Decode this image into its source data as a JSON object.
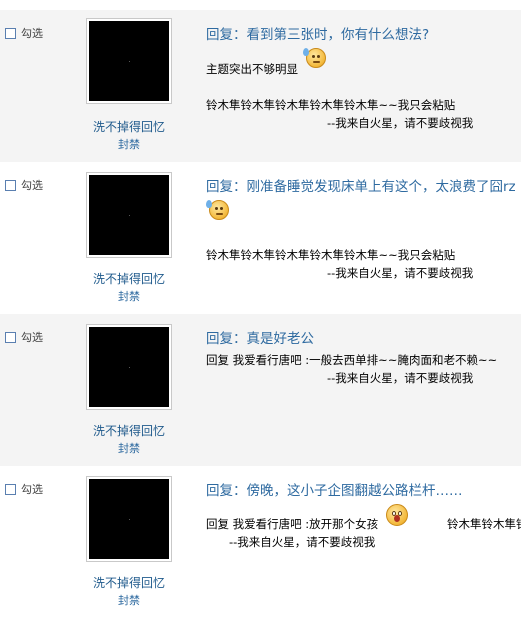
{
  "posts": [
    {
      "checkbox_label": "勾选",
      "username": "洗不掉得回忆",
      "ban_label": "封禁",
      "title": "回复：看到第三张时，你有什么想法?",
      "line1": "主题突出不够明显",
      "emoticon": "sweat-face-icon",
      "line2": "铃木隼铃木隼铃木隼铃木隼铃木隼~~我只会粘贴",
      "line3": "--我来自火星，请不要歧视我"
    },
    {
      "checkbox_label": "勾选",
      "username": "洗不掉得回忆",
      "ban_label": "封禁",
      "title": "回复：刚准备睡觉发现床单上有这个，太浪费了囧rz",
      "emoticon": "sweat-face-icon",
      "line2": "铃木隼铃木隼铃木隼铃木隼铃木隼~~我只会粘贴",
      "line3": "--我来自火星，请不要歧视我"
    },
    {
      "checkbox_label": "勾选",
      "username": "洗不掉得回忆",
      "ban_label": "封禁",
      "title": "回复：真是好老公",
      "line1": "回复 我爱看行唐吧 :一般去西单排~~腌肉面和老不赖~~",
      "line3": "--我来自火星，请不要歧视我"
    },
    {
      "checkbox_label": "勾选",
      "username": "洗不掉得回忆",
      "ban_label": "封禁",
      "title": "回复：傍晚，这小子企图翻越公路栏杆……",
      "line1": "回复 我爱看行唐吧 :放开那个女孩",
      "emoticon": "shocked-face-icon",
      "line1b": "铃木隼铃木隼铃",
      "line3": "--我来自火星，请不要歧视我"
    }
  ]
}
